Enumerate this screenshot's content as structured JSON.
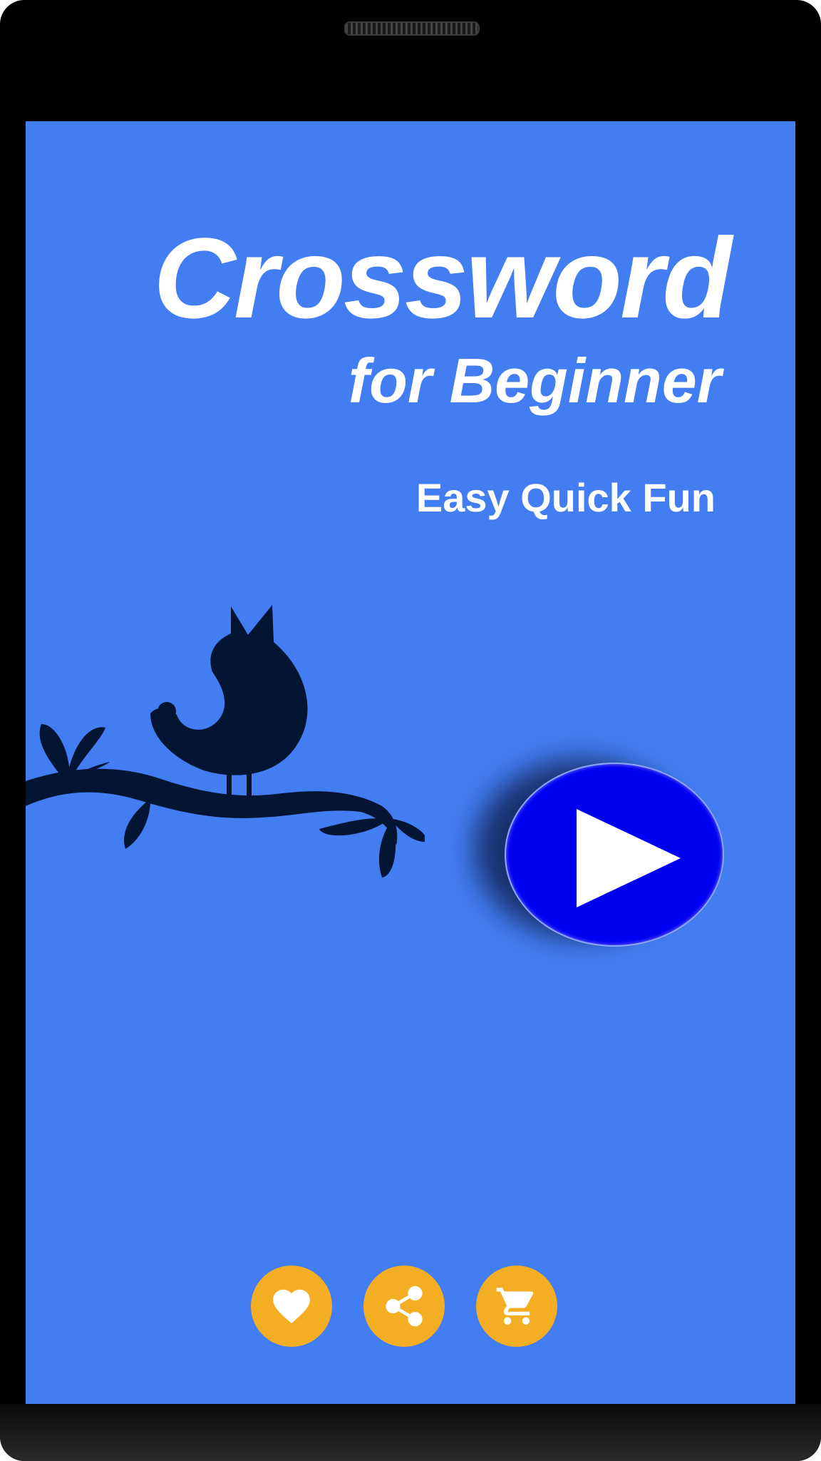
{
  "app": {
    "title": "Crossword",
    "subtitle": "for Beginner",
    "tagline": "Easy Quick Fun"
  },
  "colors": {
    "background": "#437DF2",
    "title_text": "#FFFFFF",
    "play_button": "#0000F0",
    "play_icon": "#FFFFFF",
    "action_buttons": "#F4AE23",
    "illustration": "#041433",
    "device_frame": "#000000"
  },
  "illustration": {
    "icon": "bird-on-branch-illustration"
  },
  "play_button": {
    "icon": "play-icon"
  },
  "bottom_actions": [
    {
      "icon": "heart-icon"
    },
    {
      "icon": "share-icon"
    },
    {
      "icon": "cart-icon"
    }
  ]
}
